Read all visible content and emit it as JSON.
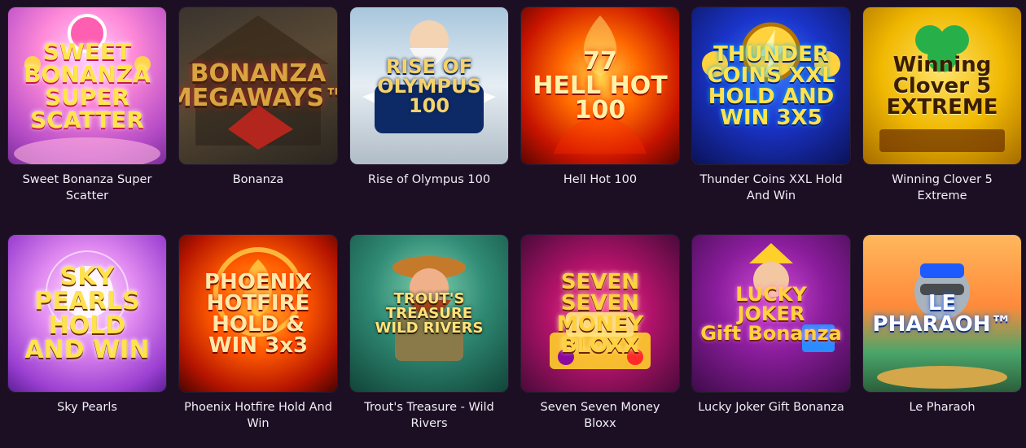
{
  "games": [
    {
      "title": "Sweet Bonanza Super Scatter",
      "logo": "SWEET\nBONANZA\nSUPER\nSCATTER",
      "icon": "candy-slot-art"
    },
    {
      "title": "Bonanza",
      "logo": "BONANZA\nMEGAWAYS™",
      "icon": "mine-slot-art"
    },
    {
      "title": "Rise of Olympus 100",
      "logo": "RISE OF\nOLYMPUS\n100",
      "icon": "zeus-slot-art"
    },
    {
      "title": "Hell Hot 100",
      "logo": "77\nHELL HOT\n100",
      "icon": "fire-seven-slot-art"
    },
    {
      "title": "Thunder Coins XXL Hold And Win",
      "logo": "THUNDER\nCOINS XXL\nHOLD AND WIN 3X5",
      "icon": "thunder-coin-slot-art"
    },
    {
      "title": "Winning Clover 5 Extreme",
      "logo": "Winning\nClover 5\nEXTREME",
      "icon": "clover-slot-art"
    },
    {
      "title": "Sky Pearls",
      "logo": "SKY\nPEARLS\nHOLD AND WIN",
      "icon": "pearl-slot-art"
    },
    {
      "title": "Phoenix Hotfire Hold And Win",
      "logo": "PHOENIX\nHOTFIRE\nHOLD & WIN 3x3",
      "icon": "phoenix-slot-art"
    },
    {
      "title": "Trout's Treasure - Wild Rivers",
      "logo": "TROUT'S TREASURE\nWILD RIVERS",
      "icon": "fisherman-slot-art"
    },
    {
      "title": "Seven Seven Money Bloxx",
      "logo": "SEVEN SEVEN\nMONEY\nBLOXX",
      "icon": "gold-bars-slot-art"
    },
    {
      "title": "Lucky Joker Gift Bonanza",
      "logo": "LUCKY\nJOKER\nGift Bonanza",
      "icon": "joker-slot-art"
    },
    {
      "title": "Le Pharaoh",
      "logo": "LE PHARAOH™",
      "icon": "raccoon-pharaoh-slot-art"
    }
  ]
}
